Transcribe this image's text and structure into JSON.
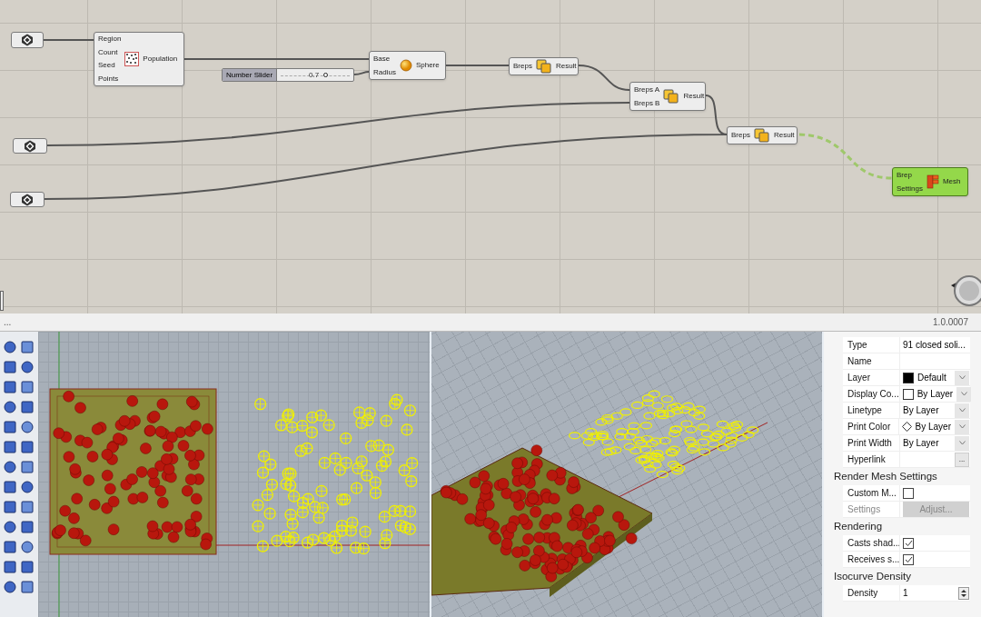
{
  "canvas": {
    "nodes": [
      {
        "kind": "param",
        "selected": false
      },
      {
        "kind": "population",
        "inputs": [
          "Region",
          "Count",
          "Seed",
          "Points"
        ],
        "outputs": [
          "Population"
        ],
        "selected": false
      },
      {
        "kind": "slider",
        "label": "Number Slider",
        "value": "0.7",
        "level": 0.63,
        "selected": false
      },
      {
        "kind": "sphere",
        "inputs": [
          "Base",
          "Radius"
        ],
        "outputs": [
          "Sphere"
        ],
        "selected": false
      },
      {
        "kind": "union",
        "inputs": [
          "Breps"
        ],
        "outputs": [
          "Result"
        ],
        "selected": false
      },
      {
        "kind": "union",
        "inputs": [
          "Breps A",
          "Breps B"
        ],
        "outputs": [
          "Result"
        ],
        "selected": false
      },
      {
        "kind": "param",
        "selected": false
      },
      {
        "kind": "param",
        "selected": false
      },
      {
        "kind": "union",
        "inputs": [
          "Breps"
        ],
        "outputs": [
          "Result"
        ],
        "selected": false
      },
      {
        "kind": "mesh",
        "inputs": [
          "Brep",
          "Settings"
        ],
        "outputs": [
          "Mesh"
        ],
        "selected": true
      }
    ]
  },
  "status_bar": {
    "left": "...",
    "version": "1.0.0007"
  },
  "properties": {
    "sections": [
      {
        "rows": [
          {
            "label": "Type",
            "kind": "text",
            "value": "91 closed soli..."
          },
          {
            "label": "Name",
            "kind": "text"
          },
          {
            "label": "Layer",
            "kind": "swatch",
            "value": "Default",
            "color": "#000000"
          },
          {
            "label": "Display Co...",
            "kind": "swatch",
            "value": "By Layer",
            "color": "#ffffff"
          },
          {
            "label": "Linetype",
            "kind": "dropdown",
            "value": "By Layer"
          },
          {
            "label": "Print Color",
            "kind": "diamond",
            "value": "By Layer"
          },
          {
            "label": "Print Width",
            "kind": "dropdown",
            "value": "By Layer"
          },
          {
            "label": "Hyperlink",
            "kind": "ellipsis",
            "value": "..."
          }
        ]
      },
      {
        "title": "Render Mesh Settings",
        "rows": [
          {
            "label": "Custom M...",
            "kind": "checkbox",
            "checked": false
          },
          {
            "label": "Settings",
            "kind": "button",
            "value": "Adjust...",
            "disabled": true
          }
        ]
      },
      {
        "title": "Rendering",
        "rows": [
          {
            "label": "Casts shad...",
            "kind": "checkbox",
            "checked": true
          },
          {
            "label": "Receives s...",
            "kind": "checkbox",
            "checked": true
          }
        ]
      },
      {
        "title": "Isocurve Density",
        "rows": [
          {
            "label": "Density",
            "kind": "spinner",
            "value": "1"
          }
        ]
      }
    ]
  }
}
